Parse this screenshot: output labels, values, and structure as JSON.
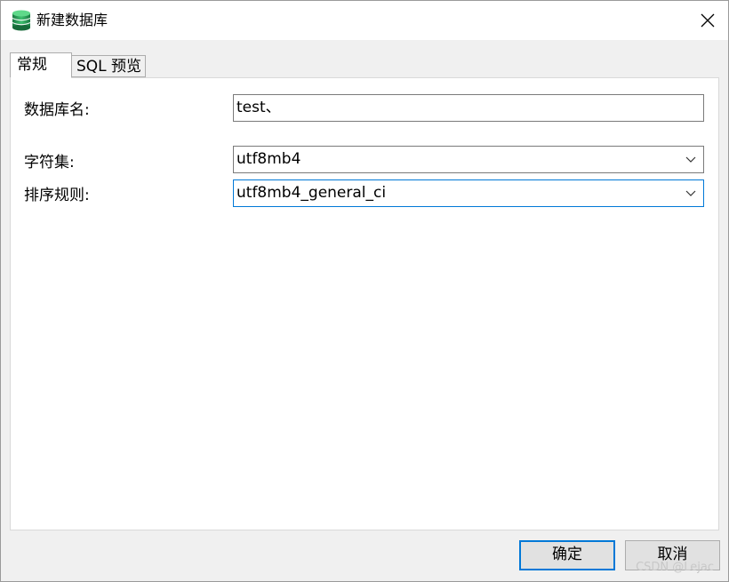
{
  "window": {
    "title": "新建数据库",
    "icon": "database-icon",
    "close_icon": "close-icon"
  },
  "tabs": [
    {
      "label": "常规",
      "active": true
    },
    {
      "label": "SQL 预览",
      "active": false
    }
  ],
  "form": {
    "db_name_label": "数据库名:",
    "db_name_value": "test、",
    "charset_label": "字符集:",
    "charset_value": "utf8mb4",
    "collation_label": "排序规则:",
    "collation_value": "utf8mb4_general_ci"
  },
  "buttons": {
    "ok_label": "确定",
    "cancel_label": "取消"
  },
  "watermark": "CSDN @Lejac",
  "colors": {
    "accent": "#0078d7",
    "db_icon": "#1e8c4e"
  }
}
